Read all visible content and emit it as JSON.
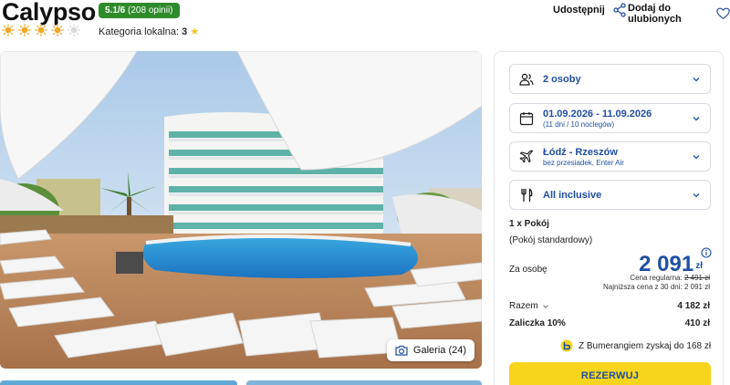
{
  "hotel": {
    "name": "Calypso",
    "rating": "5.1/6",
    "reviews": "(208 opinii)",
    "sun_rating": 4.5,
    "local_category_label": "Kategoria lokalna:",
    "local_category_value": "3"
  },
  "actions": {
    "share_label": "Udostępnij",
    "favorite_label": "Dodaj do ulubionych"
  },
  "gallery": {
    "label": "Galeria (24)"
  },
  "booking": {
    "guests": "2 osoby",
    "dates": "01.09.2026 - 11.09.2026",
    "dates_sub": "(11 dni / 10 noclegów)",
    "route": "Łódź - Rzeszów",
    "route_sub": "bez przesiadek, Enter Air",
    "board": "All inclusive",
    "room_count": "1 x Pokój",
    "room_type": "(Pokój standardowy)",
    "per_person_label": "Za osobę",
    "price": "2 091",
    "currency": "zł",
    "regular_price_label": "Cena regularna:",
    "regular_price": "2 491 zł",
    "lowest_price_text": "Najniższa cena z 30 dni: 2 091 zł",
    "total_label": "Razem",
    "total_value": "4 182 zł",
    "deposit_label": "Zaliczka 10%",
    "deposit_value": "410 zł",
    "bumerang_text": "Z Bumerangiem zyskaj do 168 zł",
    "reserve_label": "REZERWUJ"
  },
  "colors": {
    "accent_blue": "#1f4fa3",
    "rating_green": "#2e8b2a",
    "reserve_yellow": "#f7d51d",
    "sun_orange": "#f5a623"
  }
}
